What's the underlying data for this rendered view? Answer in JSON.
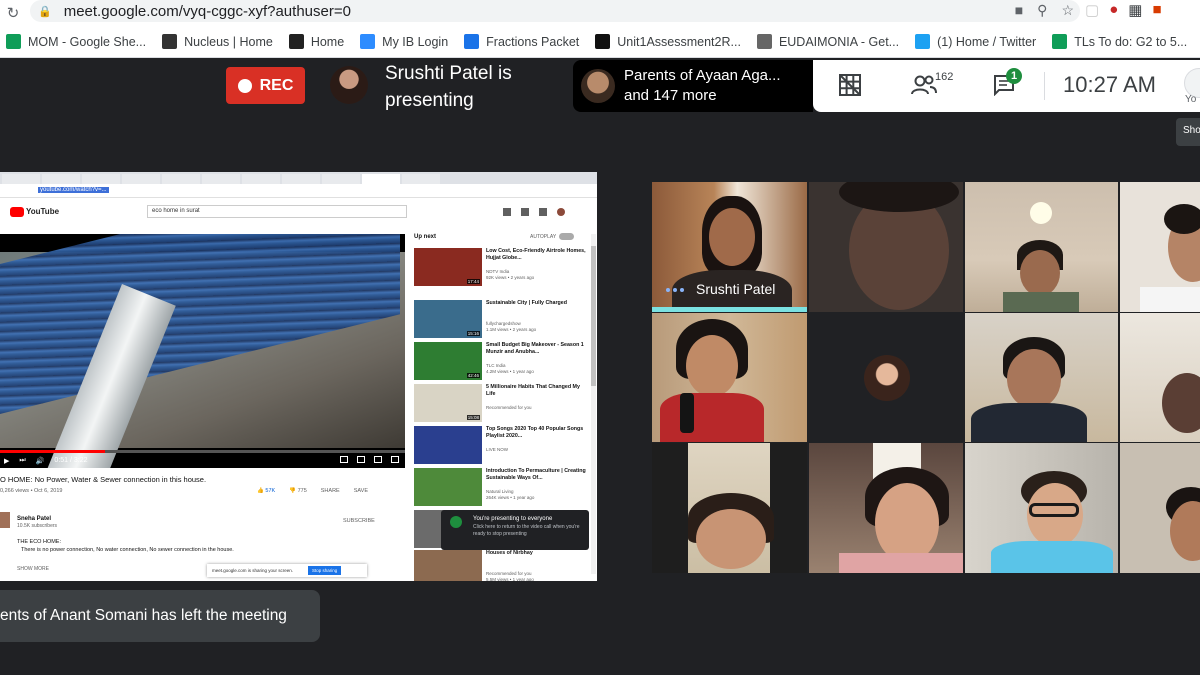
{
  "browser": {
    "url": "meet.google.com/vyq-cggc-xyf?authuser=0",
    "bookmarks": [
      {
        "label": "MOM - Google She...",
        "icon": "sheets-icon",
        "color": "#0f9d58"
      },
      {
        "label": "Nucleus | Home",
        "icon": "nucleus-icon",
        "color": "#333333"
      },
      {
        "label": "Home",
        "icon": "w-icon",
        "color": "#222222"
      },
      {
        "label": "My IB Login",
        "icon": "cloud-icon",
        "color": "#2d8cff"
      },
      {
        "label": "Fractions Packet",
        "icon": "globe-icon",
        "color": "#1a73e8"
      },
      {
        "label": "Unit1Assessment2R...",
        "icon": "bb-icon",
        "color": "#111111"
      },
      {
        "label": "EUDAIMONIA - Get...",
        "icon": "dash-icon",
        "color": "#666666"
      },
      {
        "label": "(1) Home / Twitter",
        "icon": "twitter-icon",
        "color": "#1da1f2"
      },
      {
        "label": "TLs To do: G2 to 5...",
        "icon": "sheets-icon",
        "color": "#0f9d58"
      }
    ]
  },
  "meet": {
    "rec_label": "REC",
    "presenter_line1": "Srushti Patel is",
    "presenter_line2": "presenting",
    "parents_line1": "Parents of Ayaan Aga...",
    "parents_line2": "and 147 more",
    "people_count": "162",
    "chat_badge": "1",
    "time": "10:27  AM",
    "you_label": "Yo",
    "show_tip": "Sho",
    "notification": "ents of Anant Somani has left the meeting"
  },
  "shared_screen": {
    "youtube_url": "youtube.com/watch?v=...",
    "brand": "YouTube",
    "search_text": "eco home in surat",
    "video_title": "O HOME: No Power, Water & Sewer connection in this house.",
    "video_meta": "0,266 views • Oct 6, 2019",
    "likes": "57K",
    "dislikes": "775",
    "share": "SHARE",
    "save": "SAVE",
    "time_display": "0:51 / 3:22",
    "progress": 0.26,
    "channel_name": "Sneha Patel",
    "channel_subs": "10.5K subscribers",
    "subscribe": "SUBSCRIBE",
    "desc_heading": "THE ECO HOME:",
    "desc_body": "There is no power connection, No water connection, No sewer connection in the house.",
    "show_more": "SHOW MORE",
    "stop_text": "meet.google.com is sharing your screen.",
    "stop_btn": "Stop sharing",
    "up_next": "Up next",
    "autoplay": "AUTOPLAY",
    "toast_title": "You're presenting to everyone",
    "toast_body": "Click here to return to the video call when you're ready to stop presenting",
    "related": [
      {
        "title": "Low Cost, Eco-Friendly Airtrole Homes, Hujjat Globe...",
        "channel": "NDTV India",
        "views": "92K views • 2 years ago",
        "dur": "17:44",
        "thumb": "#8a2a20"
      },
      {
        "title": "Sustainable City | Fully Charged",
        "channel": "fullychargedshow",
        "views": "1.1M views • 2 years ago",
        "dur": "15:16",
        "thumb": "#3a6c8c"
      },
      {
        "title": "Small Budget Big Makeover - Season 1 Munzir and Anubha...",
        "channel": "TLC India",
        "views": "4.2M views • 1 year ago",
        "dur": "42:46",
        "thumb": "#2e7d32"
      },
      {
        "title": "5 Millionaire Habits That Changed My Life",
        "channel": "Recommended for you",
        "views": "",
        "dur": "15:08",
        "thumb": "#d9d4c5"
      },
      {
        "title": "Top Songs 2020 Top 40 Popular Songs Playlist 2020...",
        "channel": "LIVE NOW",
        "views": "",
        "dur": "",
        "thumb": "#2a3f8f"
      },
      {
        "title": "Introduction To Permaculture | Creating Sustainable Ways Of...",
        "channel": "Natural Living",
        "views": "264K views • 1 year ago",
        "dur": "",
        "thumb": "#4e8a3a"
      },
      {
        "title": "Minimalist Home Tour",
        "channel": "Recommended for you",
        "views": "",
        "dur": "",
        "thumb": "#6b6b6b"
      },
      {
        "title": "Houses of Nirbhay",
        "channel": "Recommended for you",
        "views": "5.5M views • 1 year ago",
        "dur": "",
        "thumb": "#8c6a50"
      }
    ]
  },
  "tiles": {
    "speaker_name": "Srushti Patel"
  }
}
